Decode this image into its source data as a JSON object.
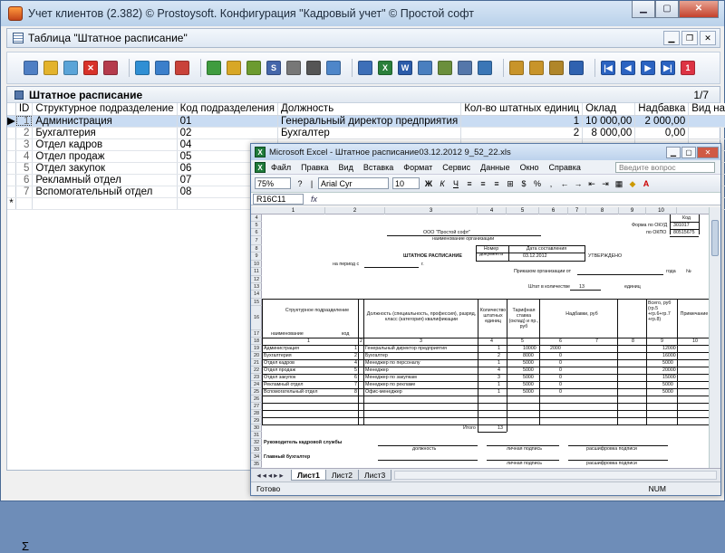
{
  "app": {
    "title": "Учет клиентов (2.382) © Prostoysoft. Конфигурация \"Кадровый учет\" © Простой софт"
  },
  "doc": {
    "title": "Таблица \"Штатное расписание\""
  },
  "grid": {
    "title": "Штатное расписание",
    "counter": "1/7",
    "headers": [
      "ID",
      "Структурное подразделение",
      "Код подразделения",
      "Должность",
      "Кол-во штатных единиц",
      "Оклад",
      "Надбавка",
      "Вид надбавки"
    ],
    "rows": [
      {
        "id": "1",
        "dept": "Администрация",
        "code": "01",
        "position": "Генеральный директор предприятия",
        "count": "1",
        "salary": "10 000,00",
        "bonus": "2 000,00"
      },
      {
        "id": "2",
        "dept": "Бухгалтерия",
        "code": "02",
        "position": "Бухгалтер",
        "count": "2",
        "salary": "8 000,00",
        "bonus": "0,00"
      },
      {
        "id": "3",
        "dept": "Отдел кадров",
        "code": "04",
        "position": "",
        "count": "",
        "salary": "",
        "bonus": ""
      },
      {
        "id": "4",
        "dept": "Отдел продаж",
        "code": "05",
        "position": "",
        "count": "",
        "salary": "",
        "bonus": ""
      },
      {
        "id": "5",
        "dept": "Отдел закупок",
        "code": "06",
        "position": "",
        "count": "",
        "salary": "",
        "bonus": ""
      },
      {
        "id": "6",
        "dept": "Рекламный отдел",
        "code": "07",
        "position": "",
        "count": "",
        "salary": "",
        "bonus": ""
      },
      {
        "id": "7",
        "dept": "Вспомогательный отдел",
        "code": "08",
        "position": "",
        "count": "",
        "salary": "",
        "bonus": ""
      }
    ],
    "sigma": "Σ"
  },
  "excel": {
    "title": "Microsoft Excel - Штатное расписание03.12.2012 9_52_22.xls",
    "menu": [
      "Файл",
      "Правка",
      "Вид",
      "Вставка",
      "Формат",
      "Сервис",
      "Данные",
      "Окно",
      "Справка"
    ],
    "ask_placeholder": "Введите вопрос",
    "zoom": "75%",
    "font": "Arial Cyr",
    "font_size": "10",
    "cell_ref": "R16C11",
    "fx": "fx",
    "tabs": [
      "Лист1",
      "Лист2",
      "Лист3"
    ],
    "status": "Готово",
    "status_num": "NUM",
    "sheet": {
      "org": "ООО \"Простой софт\"",
      "org_caption": "наименование организации",
      "okud_label": "Форма по ОКУД",
      "okud": "301017",
      "okpo_label": "по ОКПО",
      "okpo": "80515675",
      "kod": "Код",
      "doc_num_label": "Номер документа",
      "date_label": "Дата составления",
      "doc_date": "03.12.2012",
      "heading": "ШТАТНОЕ РАСПИСАНИЕ",
      "approved": "УТВЕРЖДЕНО",
      "period": "на период с",
      "period_to": "г.",
      "order": "Приказом организации от",
      "year": "года",
      "no": "№",
      "staff": "Штат в количестве",
      "staff_count": "13",
      "units": "единиц",
      "col_dept": "Структурное подразделение",
      "col_name": "наименование",
      "col_code": "код",
      "col_position": "Должность (специальность, профессия), разряд, класс (категория) квалификации",
      "col_count": "Количество штатных единиц",
      "col_rate": "Тарифная ставка (оклад) и пр., руб",
      "col_bonus": "Надбавки, руб",
      "col_total": "Всего, руб (гр.5 +гр.6+гр.7 +гр.8)",
      "col_note": "Примечание",
      "col_nums": [
        "1",
        "2",
        "3",
        "4",
        "5",
        "6",
        "7",
        "8",
        "9",
        "10"
      ],
      "data": [
        {
          "dept": "Администрация",
          "code": "1",
          "pos": "Генеральный директор предприятия",
          "n": "1",
          "rate": "10000",
          "bonus": "2000",
          "total": "12000"
        },
        {
          "dept": "Бухгалтерия",
          "code": "2",
          "pos": "Бухгалтер",
          "n": "2",
          "rate": "8000",
          "bonus": "0",
          "total": "16000"
        },
        {
          "dept": "Отдел кадров",
          "code": "4",
          "pos": "Менеджер по персоналу",
          "n": "1",
          "rate": "5000",
          "bonus": "0",
          "total": "5000"
        },
        {
          "dept": "Отдел продаж",
          "code": "5",
          "pos": "Менеджер",
          "n": "4",
          "rate": "5000",
          "bonus": "0",
          "total": "20000"
        },
        {
          "dept": "Отдел закупок",
          "code": "6",
          "pos": "Менеджер по закупкам",
          "n": "3",
          "rate": "5000",
          "bonus": "0",
          "total": "15000"
        },
        {
          "dept": "Рекламный отдел",
          "code": "7",
          "pos": "Менеджер по рекламе",
          "n": "1",
          "rate": "5000",
          "bonus": "0",
          "total": "5000"
        },
        {
          "dept": "Вспомогательный отдел",
          "code": "8",
          "pos": "Офис-менеджер",
          "n": "1",
          "rate": "5000",
          "bonus": "0",
          "total": "5000"
        }
      ],
      "total_label": "Итого",
      "total_count": "13",
      "head_hr": "Руководитель кадровой службы",
      "sig_pos": "должность",
      "sig_sign": "личная подпись",
      "sig_decode": "расшифровка подписи",
      "head_acc": "Главный бухгалтер",
      "row_nums": [
        "4",
        "5",
        "6",
        "7",
        "8",
        "9",
        "10",
        "11",
        "12",
        "13",
        "14",
        "15",
        "16",
        "17",
        "18",
        "19",
        "20",
        "21",
        "22",
        "23",
        "24",
        "25",
        "26",
        "27",
        "28",
        "29",
        "30",
        "31",
        "32",
        "33",
        "34",
        "35"
      ],
      "col_hdr": [
        "1",
        "2",
        "3",
        "4",
        "5",
        "6",
        "7",
        "8",
        "9",
        "10"
      ]
    }
  }
}
